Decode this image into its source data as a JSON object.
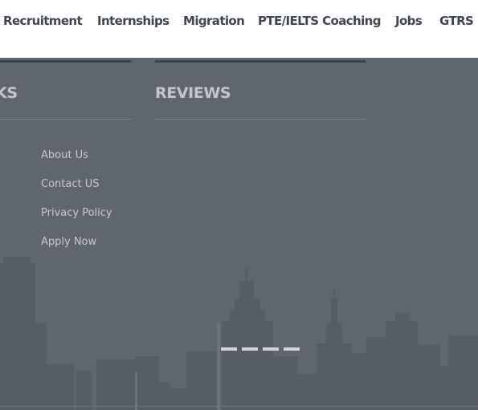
{
  "nav": {
    "items": [
      {
        "label": "Recruitment"
      },
      {
        "label": "Internships"
      },
      {
        "label": "Migration"
      },
      {
        "label": "PTE/IELTS Coaching"
      },
      {
        "label": "Jobs"
      },
      {
        "label": "GTRS S"
      }
    ]
  },
  "footer": {
    "links_heading": "KS",
    "reviews_heading": "REVIEWS",
    "links": [
      {
        "label": "About Us"
      },
      {
        "label": "Contact US"
      },
      {
        "label": "Privacy Policy"
      },
      {
        "label": "Apply Now"
      }
    ],
    "slider_dots": 4
  },
  "colors": {
    "footer_bg": "#5f666d",
    "skyline": "#535a61",
    "heading_text": "#c3c6ca",
    "link_text": "#c6c9cd",
    "nav_text": "#3f4650"
  }
}
